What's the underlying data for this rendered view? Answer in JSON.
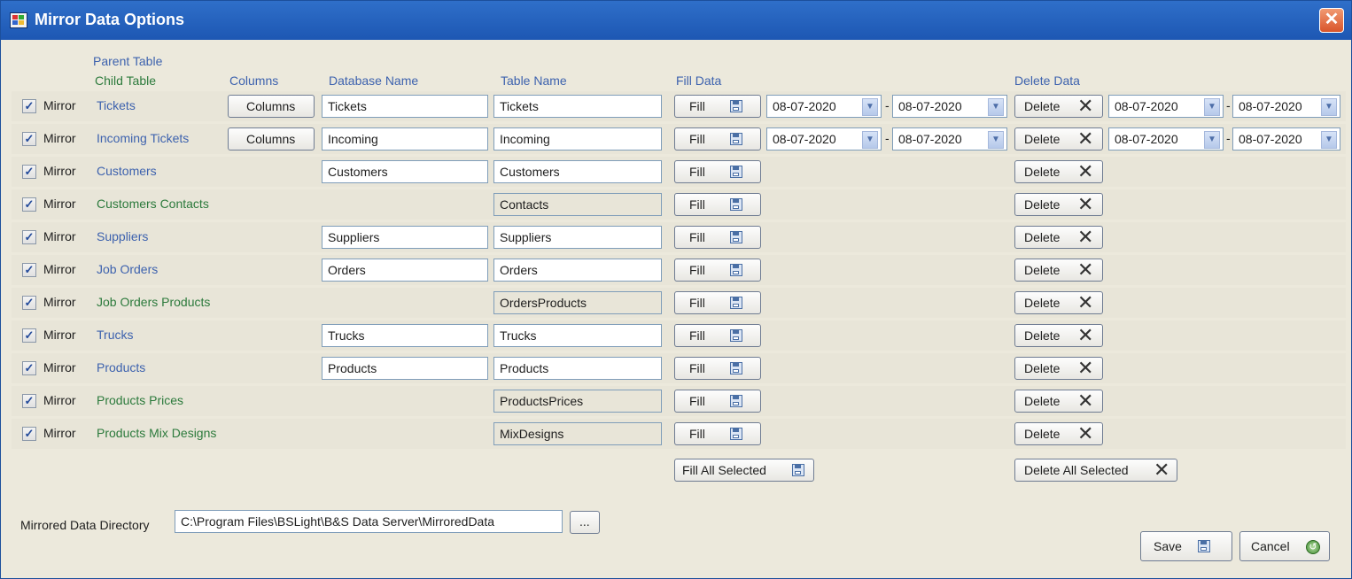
{
  "window": {
    "title": "Mirror Data Options",
    "close_glyph": "✕",
    "app_icon": "app-window-icon"
  },
  "headers": {
    "parent_table": "Parent Table",
    "child_table": "Child Table",
    "columns": "Columns",
    "database_name": "Database Name",
    "table_name": "Table Name",
    "fill_data": "Fill Data",
    "delete_data": "Delete Data"
  },
  "labels": {
    "mirror": "Mirror",
    "columns_btn": "Columns",
    "fill_btn": "Fill",
    "delete_btn": "Delete",
    "date_separator": "-"
  },
  "rows": [
    {
      "checked": true,
      "name": "Tickets",
      "kind": "parent",
      "has_columns": true,
      "db_name": "Tickets",
      "table_name": "Tickets",
      "fill_from": "08-07-2020",
      "fill_to": "08-07-2020",
      "del_from": "08-07-2020",
      "del_to": "08-07-2020"
    },
    {
      "checked": true,
      "name": "Incoming Tickets",
      "kind": "parent",
      "has_columns": true,
      "db_name": "Incoming",
      "table_name": "Incoming",
      "fill_from": "08-07-2020",
      "fill_to": "08-07-2020",
      "del_from": "08-07-2020",
      "del_to": "08-07-2020"
    },
    {
      "checked": true,
      "name": "Customers",
      "kind": "parent",
      "db_name": "Customers",
      "table_name": "Customers"
    },
    {
      "checked": true,
      "name": "Customers Contacts",
      "kind": "child",
      "table_name": "Contacts"
    },
    {
      "checked": true,
      "name": "Suppliers",
      "kind": "parent",
      "db_name": "Suppliers",
      "table_name": "Suppliers"
    },
    {
      "checked": true,
      "name": "Job Orders",
      "kind": "parent",
      "db_name": "Orders",
      "table_name": "Orders"
    },
    {
      "checked": true,
      "name": "Job Orders Products",
      "kind": "child",
      "table_name": "OrdersProducts"
    },
    {
      "checked": true,
      "name": "Trucks",
      "kind": "parent",
      "db_name": "Trucks",
      "table_name": "Trucks"
    },
    {
      "checked": true,
      "name": "Products",
      "kind": "parent",
      "db_name": "Products",
      "table_name": "Products"
    },
    {
      "checked": true,
      "name": "Products Prices",
      "kind": "child",
      "table_name": "ProductsPrices"
    },
    {
      "checked": true,
      "name": "Products Mix Designs",
      "kind": "child",
      "table_name": "MixDesigns"
    }
  ],
  "actions": {
    "fill_all": "Fill All Selected",
    "delete_all": "Delete All Selected"
  },
  "directory": {
    "label": "Mirrored Data Directory",
    "value": "C:\\Program Files\\BSLight\\B&S Data Server\\MirroredData",
    "browse": "..."
  },
  "footer": {
    "save": "Save",
    "cancel": "Cancel"
  },
  "colors": {
    "title_bar": "#1d57b3",
    "parent_text": "#3d62ae",
    "child_text": "#2c7a3c",
    "background": "#ece9dc"
  }
}
